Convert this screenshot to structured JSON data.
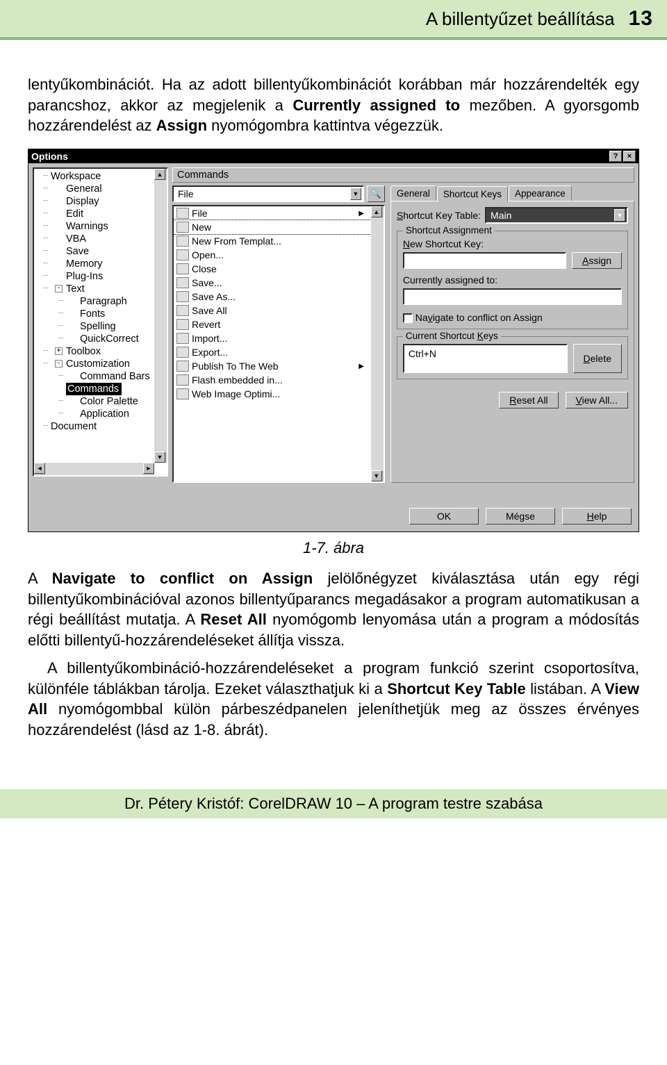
{
  "header": {
    "title": "A billentyűzet beállítása",
    "page": "13"
  },
  "para1_a": "lentyűkombinációt. Ha az adott billentyűkombinációt korábban már hozzárendelték egy parancshoz, akkor az megjelenik a ",
  "para1_b": "Currently assigned to",
  "para1_c": " mezőben. A gyorsgomb hozzárendelést az ",
  "para1_d": "Assign",
  "para1_e": " nyomógombra kattintva végezzük.",
  "caption": "1-7. ábra",
  "para2_a": "A ",
  "para2_b": "Navigate to conflict on Assign",
  "para2_c": " jelölőnégyzet kiválasztása után egy régi billentyűkombinációval azonos billentyűparancs megadásakor a program automatikusan a régi beállítást mutatja. A ",
  "para2_d": "Reset All",
  "para2_e": " nyomógomb lenyomása után a program a módosítás előtti billentyű-hozzárendeléseket állítja vissza.",
  "para3_a": "A billentyűkombináció-hozzárendeléseket a program funkció szerint csoportosítva, különféle táblákban tárolja. Ezeket választhatjuk ki a ",
  "para3_b": "Shortcut Key Table",
  "para3_c": " listában. A ",
  "para3_d": "View All",
  "para3_e": " nyomógombbal külön párbeszédpanelen jeleníthetjük meg az összes érvényes hozzárendelést (lásd az 1-8. ábrát).",
  "footer": "Dr. Pétery Kristóf: CorelDRAW 10 – A program testre szabása",
  "dialog": {
    "title": "Options",
    "tree": [
      {
        "l": 0,
        "t": "Workspace"
      },
      {
        "l": 1,
        "t": "General"
      },
      {
        "l": 1,
        "t": "Display"
      },
      {
        "l": 1,
        "t": "Edit"
      },
      {
        "l": 1,
        "t": "Warnings"
      },
      {
        "l": 1,
        "t": "VBA"
      },
      {
        "l": 1,
        "t": "Save"
      },
      {
        "l": 1,
        "t": "Memory"
      },
      {
        "l": 1,
        "t": "Plug-Ins"
      },
      {
        "l": 1,
        "t": "Text",
        "exp": "-"
      },
      {
        "l": 2,
        "t": "Paragraph"
      },
      {
        "l": 2,
        "t": "Fonts"
      },
      {
        "l": 2,
        "t": "Spelling"
      },
      {
        "l": 2,
        "t": "QuickCorrect"
      },
      {
        "l": 1,
        "t": "Toolbox",
        "exp": "+"
      },
      {
        "l": 1,
        "t": "Customization",
        "exp": "-"
      },
      {
        "l": 2,
        "t": "Command Bars"
      },
      {
        "l": 2,
        "t": "Commands",
        "sel": true
      },
      {
        "l": 2,
        "t": "Color Palette"
      },
      {
        "l": 2,
        "t": "Application"
      },
      {
        "l": 0,
        "t": "Document"
      }
    ],
    "panel_title": "Commands",
    "category": "File",
    "commands": [
      {
        "t": "File",
        "sub": true
      },
      {
        "t": "New",
        "sel": true
      },
      {
        "t": "New From Templat..."
      },
      {
        "t": "Open..."
      },
      {
        "t": "Close"
      },
      {
        "t": "Save..."
      },
      {
        "t": "Save As..."
      },
      {
        "t": "Save All"
      },
      {
        "t": "Revert"
      },
      {
        "t": "Import..."
      },
      {
        "t": "Export..."
      },
      {
        "t": "Publish To The Web",
        "sub": true
      },
      {
        "t": "Flash embedded in..."
      },
      {
        "t": "Web Image Optimi..."
      }
    ],
    "tabs": [
      "General",
      "Shortcut Keys",
      "Appearance"
    ],
    "tab_active": 1,
    "sk_table_label": "Shortcut Key Table:",
    "sk_table_value": "Main",
    "group_assign": "Shortcut Assignment",
    "new_sk_label": "New Shortcut Key:",
    "assign_btn": "Assign",
    "cur_assigned_label": "Currently assigned to:",
    "nav_label": "Navigate to conflict on Assign",
    "group_current": "Current Shortcut Keys",
    "current_keys": "Ctrl+N",
    "delete_btn": "Delete",
    "reset_btn": "Reset All",
    "view_btn": "View All...",
    "ok": "OK",
    "cancel": "Mégse",
    "help": "Help"
  }
}
